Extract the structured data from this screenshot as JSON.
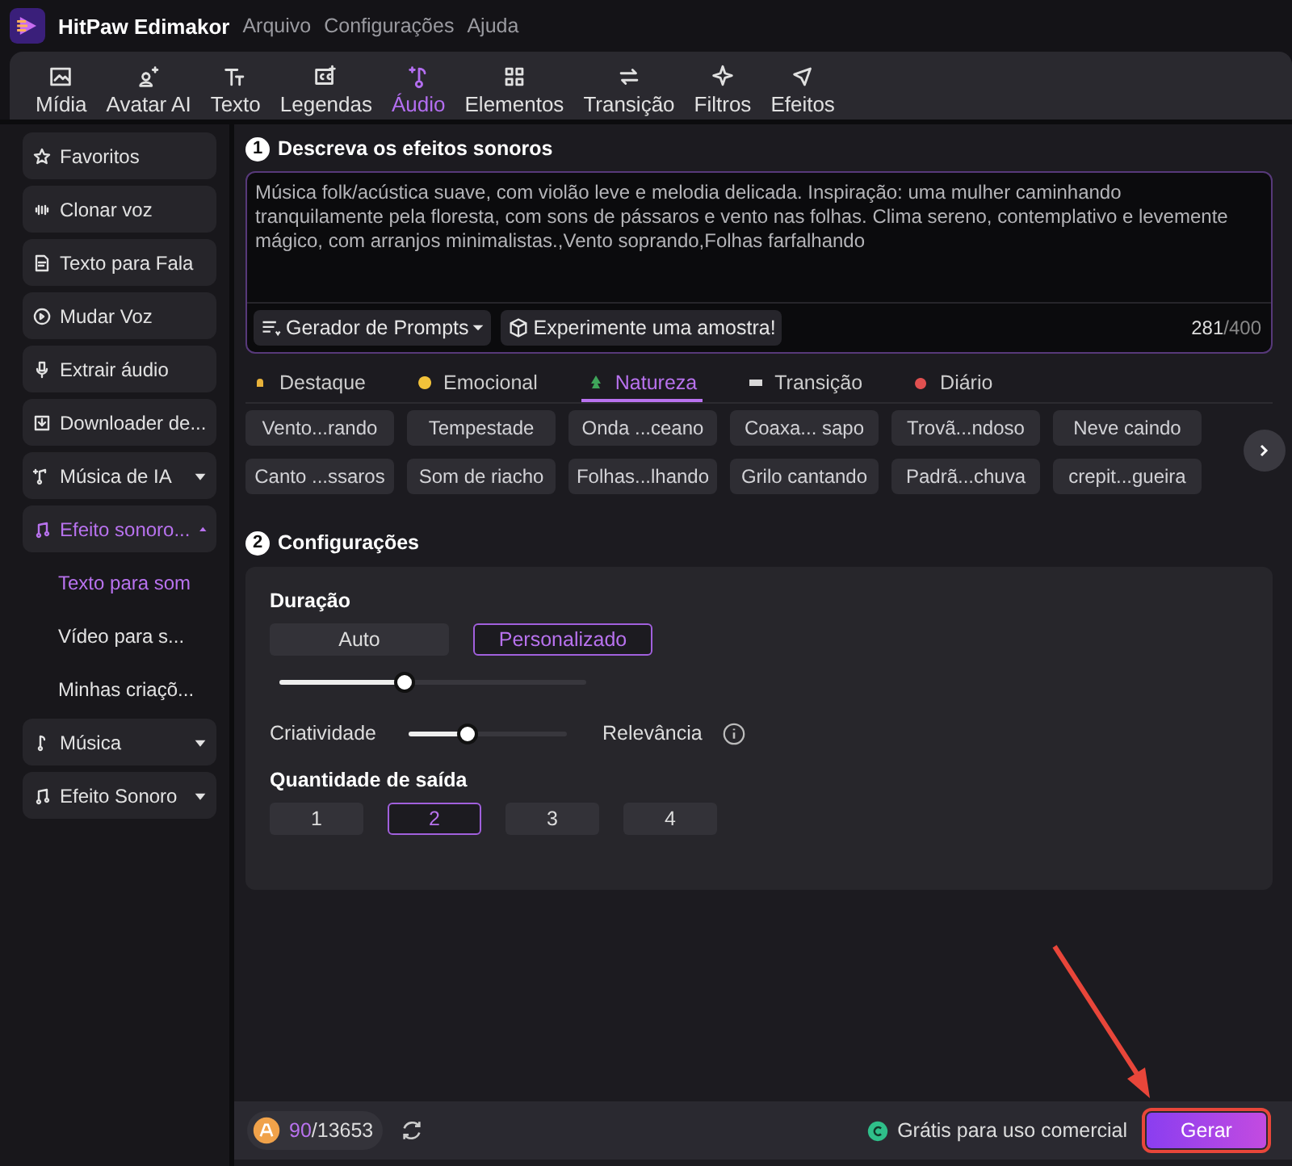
{
  "app": {
    "title": "HitPaw Edimakor",
    "menu": [
      "Arquivo",
      "Configurações",
      "Ajuda"
    ]
  },
  "toolbar": [
    {
      "label": "Mídia",
      "selected": false
    },
    {
      "label": "Avatar AI",
      "selected": false
    },
    {
      "label": "Texto",
      "selected": false
    },
    {
      "label": "Legendas",
      "selected": false
    },
    {
      "label": "Áudio",
      "selected": true
    },
    {
      "label": "Elementos",
      "selected": false
    },
    {
      "label": "Transição",
      "selected": false
    },
    {
      "label": "Filtros",
      "selected": false
    },
    {
      "label": "Efeitos",
      "selected": false
    }
  ],
  "sidebar": {
    "items": [
      {
        "label": "Favoritos",
        "selected": false
      },
      {
        "label": "Clonar voz",
        "selected": false
      },
      {
        "label": "Texto para Fala",
        "selected": false
      },
      {
        "label": "Mudar Voz",
        "selected": false
      },
      {
        "label": "Extrair áudio",
        "selected": false
      },
      {
        "label": "Downloader de...",
        "selected": false
      },
      {
        "label": "Música de IA",
        "selected": false,
        "expanded": false
      },
      {
        "label": "Efeito sonoro...",
        "selected": true,
        "expanded": true,
        "children": [
          {
            "label": "Texto para som",
            "selected": true
          },
          {
            "label": "Vídeo para s...",
            "selected": false
          },
          {
            "label": "Minhas criaçõ...",
            "selected": false
          }
        ]
      },
      {
        "label": "Música",
        "selected": false,
        "expanded": false
      },
      {
        "label": "Efeito Sonoro",
        "selected": false,
        "expanded": false
      }
    ]
  },
  "describe": {
    "step": "1",
    "title": "Descreva os efeitos sonoros",
    "value": "Música folk/acústica suave, com violão leve e melodia delicada. Inspiração: uma mulher caminhando tranquilamente pela floresta, com sons de pássaros e vento nas folhas. Clima sereno, contemplativo e levemente mágico, com arranjos minimalistas.,Vento soprando,Folhas farfalhando",
    "prompt_button": "Gerador de Prompts",
    "sample_button": "Experimente uma amostra!",
    "count": "281",
    "max": "/400"
  },
  "categories": [
    {
      "label": "Destaque",
      "selected": false
    },
    {
      "label": "Emocional",
      "selected": false
    },
    {
      "label": "Natureza",
      "selected": true
    },
    {
      "label": "Transição",
      "selected": false
    },
    {
      "label": "Diário",
      "selected": false
    }
  ],
  "chips": [
    [
      "Vento...rando",
      "Tempestade",
      "Onda ...ceano",
      "Coaxa... sapo",
      "Trovã...ndoso",
      "Neve caindo"
    ],
    [
      "Canto ...ssaros",
      "Som de riacho",
      "Folhas...lhando",
      "Grilo cantando",
      "Padrã...chuva",
      "crepit...gueira"
    ]
  ],
  "settings": {
    "step": "2",
    "title": "Configurações",
    "duration_label": "Duração",
    "duration_options": [
      {
        "label": "Auto",
        "selected": false
      },
      {
        "label": "Personalizado",
        "selected": true
      }
    ],
    "duration_slider": {
      "level": 0.38
    },
    "creativity_label": "Criatividade",
    "relevance_label": "Relevância",
    "balance_slider": {
      "level": 0.33
    },
    "quantity_label": "Quantidade de saída",
    "quantity_options": [
      {
        "label": "1",
        "selected": false
      },
      {
        "label": "2",
        "selected": true
      },
      {
        "label": "3",
        "selected": false
      },
      {
        "label": "4",
        "selected": false
      }
    ]
  },
  "footer": {
    "credits_used": "90",
    "credits_total": "/13653",
    "license": "Grátis para uso comercial",
    "generate": "Gerar",
    "highlighted": true
  }
}
